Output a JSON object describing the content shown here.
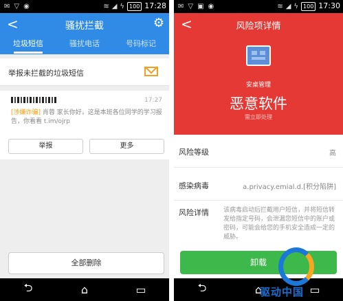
{
  "left": {
    "status": {
      "time": "17:28",
      "battery": "100"
    },
    "header": {
      "back": "<",
      "title": "骚扰拦截",
      "settings_icon": "gear-icon"
    },
    "tabs": [
      {
        "label": "垃圾短信",
        "active": true
      },
      {
        "label": "骚扰电话",
        "active": false
      },
      {
        "label": "号码标记",
        "active": false
      }
    ],
    "report": {
      "label": "举报未拦截的垃圾短信",
      "icon": "mail-icon"
    },
    "message": {
      "time": "17:27",
      "tag": "[涉嫌诈骗]",
      "body": "肖蓉 家长你好，这是本班各位同学的学习报告，你看看 t.im/ojrp"
    },
    "buttons": {
      "report": "举报",
      "more": "更多"
    },
    "delete_all": "全部删除"
  },
  "right": {
    "status": {
      "time": "17:30",
      "battery": "100"
    },
    "header": {
      "back": "<",
      "title": "风险项详情"
    },
    "app_name": "安桌管理",
    "risk_type": "恶意软件",
    "hint": "需立即处理",
    "rows": {
      "level": {
        "label": "风险等级",
        "value": "高"
      },
      "virus": {
        "label": "感染病毒",
        "value": "a.privacy.emial.d.[积分陷阱]"
      },
      "detail": {
        "label": "风险详情",
        "value": "该病毒启动后拦截用户短信，并将短信转发给指定号码，会泄漏您短信中的账户或密码，可能会给您的手机安全造成一定的威胁。"
      }
    },
    "uninstall": "卸载"
  },
  "nav": {
    "back": "⮌",
    "home": "⌂",
    "recent": "▭"
  },
  "watermark": "驱动中国",
  "colors": {
    "blue": "#2f8be6",
    "red": "#e53935",
    "green": "#3db84a"
  }
}
